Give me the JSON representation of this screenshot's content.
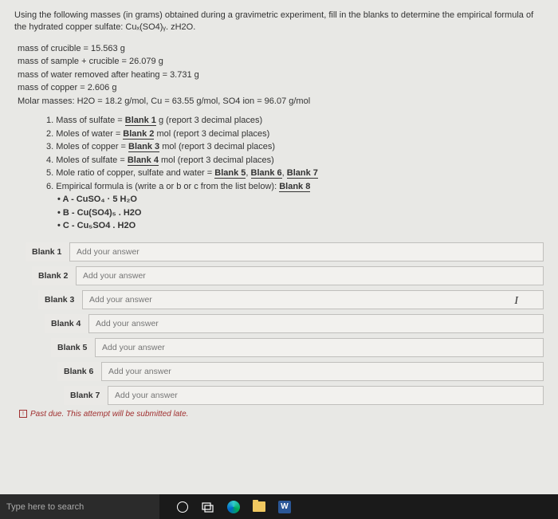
{
  "intro": "Using the following masses (in grams) obtained during a gravimetric experiment, fill in the blanks to determine the empirical formula of the hydrated copper sulfate: Cuₓ(SO4)ᵧ. zH2O.",
  "measurements": {
    "m1": "mass of crucible = 15.563 g",
    "m2": "mass of sample + crucible = 26.079 g",
    "m3": "mass of water removed after heating = 3.731 g",
    "m4": "mass of copper = 2.606 g",
    "m5": "Molar masses: H2O = 18.2 g/mol, Cu = 63.55 g/mol, SO4 ion = 96.07 g/mol"
  },
  "questions": {
    "q1_pre": "1. Mass of sulfate = ",
    "q1_blank": "Blank 1",
    "q1_post": " g (report 3 decimal places)",
    "q2_pre": "2. Moles of water = ",
    "q2_blank": "Blank 2",
    "q2_post": " mol (report 3 decimal places)",
    "q3_pre": "3. Moles of copper = ",
    "q3_blank": "Blank 3",
    "q3_post": " mol (report 3 decimal places)",
    "q4_pre": "4. Moles of sulfate = ",
    "q4_blank": "Blank 4",
    "q4_post": " mol (report 3 decimal places)",
    "q5_pre": "5. Mole ratio of copper, sulfate and water = ",
    "q5_b1": "Blank 5",
    "q5_sep1": ", ",
    "q5_b2": "Blank 6",
    "q5_sep2": ", ",
    "q5_b3": "Blank 7",
    "q6_pre": "6. Empirical formula is (write a or b or c from the list below): ",
    "q6_blank": "Blank 8",
    "optA": "A - CuSO₄ · 5 H₂O",
    "optB": "B - Cu(SO4)₅ . H2O",
    "optC": "C - Cu₅SO4 . H2O"
  },
  "blanks": [
    {
      "label": "Blank 1",
      "placeholder": "Add your answer"
    },
    {
      "label": "Blank 2",
      "placeholder": "Add your answer"
    },
    {
      "label": "Blank 3",
      "placeholder": "Add your answer"
    },
    {
      "label": "Blank 4",
      "placeholder": "Add your answer"
    },
    {
      "label": "Blank 5",
      "placeholder": "Add your answer"
    },
    {
      "label": "Blank 6",
      "placeholder": "Add your answer"
    },
    {
      "label": "Blank 7",
      "placeholder": "Add your answer"
    }
  ],
  "past_due": "Past due. This attempt will be submitted late.",
  "taskbar": {
    "search": "Type here to search",
    "word": "W"
  },
  "cursor": "I"
}
